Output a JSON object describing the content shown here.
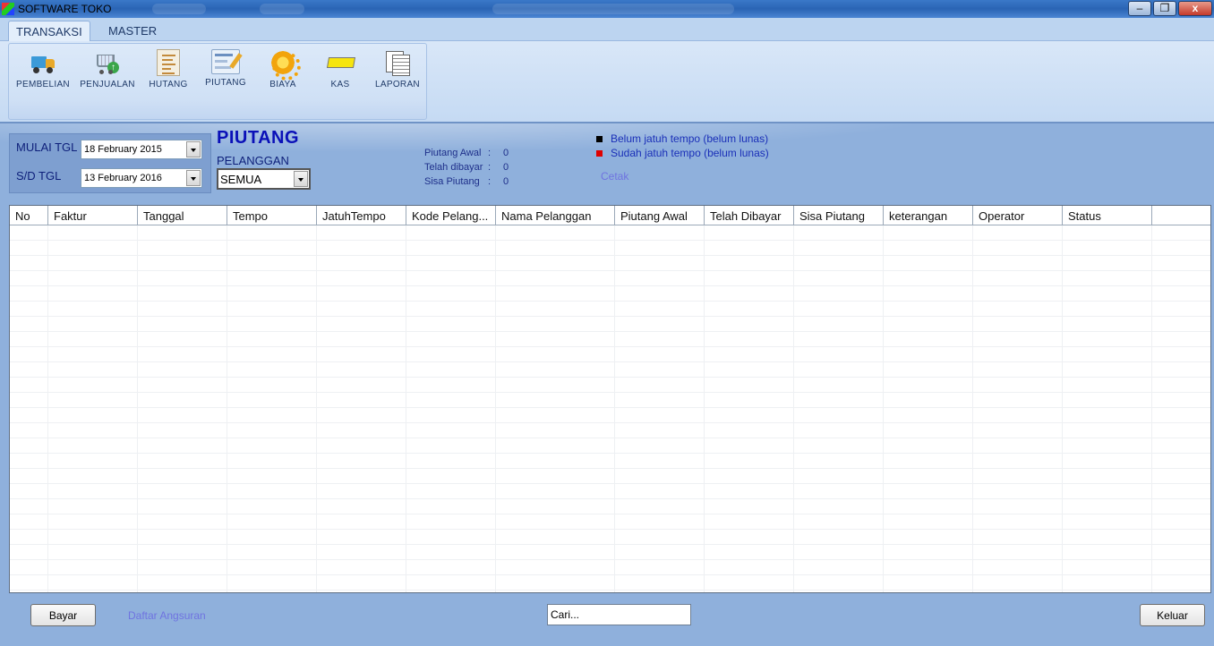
{
  "window": {
    "title": "SOFTWARE TOKO",
    "minimize": "‒",
    "maximize": "❐",
    "close": "x"
  },
  "ribbon": {
    "tabs": [
      {
        "label": "TRANSAKSI",
        "active": true
      },
      {
        "label": "MASTER",
        "active": false
      }
    ],
    "buttons": [
      {
        "label": "PEMBELIAN",
        "icon": "truck-icon"
      },
      {
        "label": "PENJUALAN",
        "icon": "shopping-cart-icon"
      },
      {
        "label": "HUTANG",
        "icon": "ledger-icon"
      },
      {
        "label": "PIUTANG",
        "icon": "invoice-card-icon"
      },
      {
        "label": "BIAYA",
        "icon": "gear-icon"
      },
      {
        "label": "KAS",
        "icon": "cash-bar-icon"
      },
      {
        "label": "LAPORAN",
        "icon": "report-pages-icon"
      }
    ]
  },
  "filter": {
    "start_label": "MULAI TGL",
    "start_value": "18 February 2015",
    "end_label": "S/D TGL",
    "end_value": "13 February 2016"
  },
  "page": {
    "title": "PIUTANG",
    "customer_label": "PELANGGAN",
    "customer_value": "SEMUA"
  },
  "summary": {
    "rows": [
      {
        "label": "Piutang Awal",
        "sep": ":",
        "value": "0"
      },
      {
        "label": "Telah dibayar",
        "sep": ":",
        "value": "0"
      },
      {
        "label": "Sisa Piutang",
        "sep": ":",
        "value": "0"
      }
    ]
  },
  "legend": {
    "items": [
      {
        "text": "Belum jatuh tempo (belum lunas)",
        "color": "#000000"
      },
      {
        "text": "Sudah jatuh tempo (belum lunas)",
        "color": "#e00000"
      }
    ],
    "print_link": "Cetak"
  },
  "table": {
    "columns": [
      "No",
      "Faktur",
      "Tanggal",
      "Tempo",
      "JatuhTempo",
      "Kode Pelang...",
      "Nama Pelanggan",
      "Piutang Awal",
      "Telah Dibayar",
      "Sisa Piutang",
      "keterangan",
      "Operator",
      "Status"
    ],
    "rows": []
  },
  "footer": {
    "pay_button": "Bayar",
    "installments_link": "Daftar Angsuran",
    "search_value": "Cari...",
    "exit_button": "Keluar"
  }
}
